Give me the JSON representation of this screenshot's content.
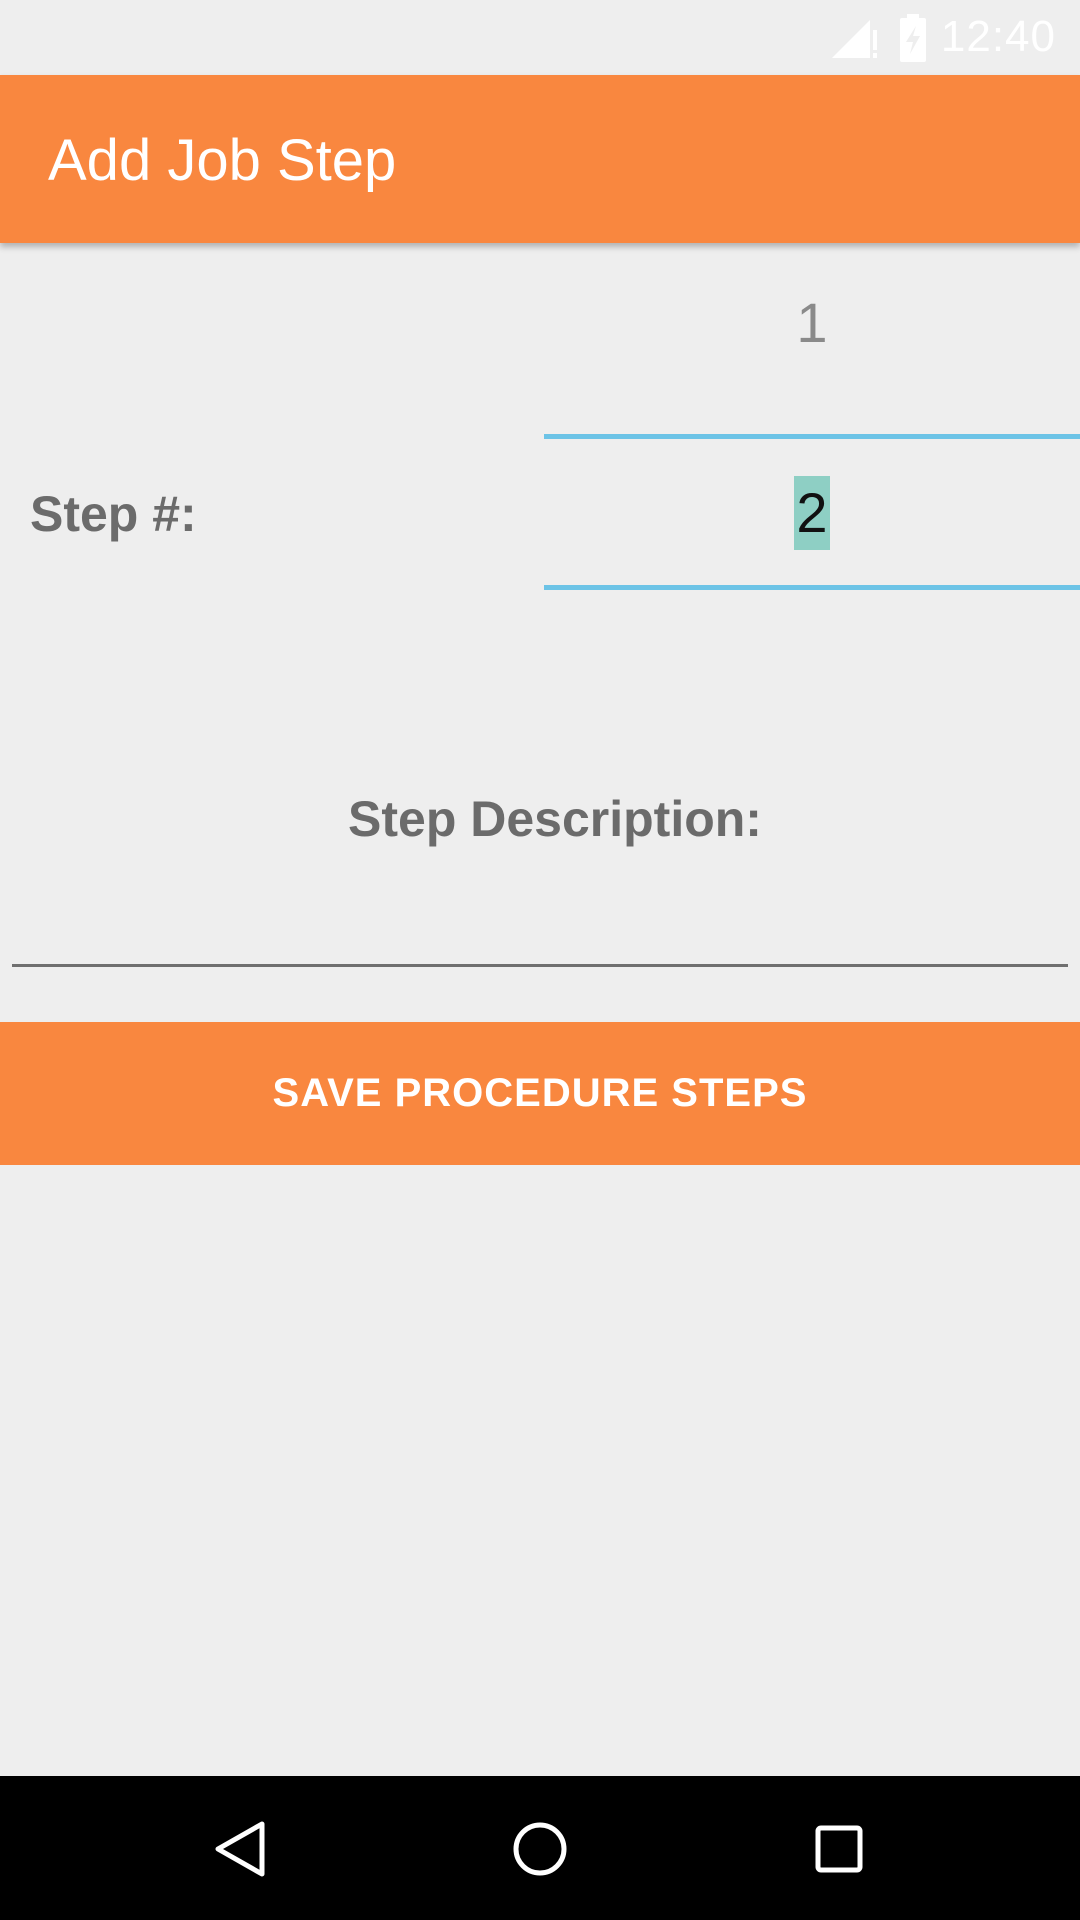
{
  "status_bar": {
    "time": "12:40",
    "icons": [
      "signal-no-data-icon",
      "battery-charging-icon"
    ]
  },
  "app_bar": {
    "title": "Add Job Step",
    "color": "#f9873f"
  },
  "form": {
    "previous_step_value": "1",
    "step_label": "Step #:",
    "step_value": "2",
    "description_label": "Step Description:",
    "description_value": ""
  },
  "save_button": {
    "label": "SAVE PROCEDURE STEPS"
  },
  "nav_bar": {
    "icons": [
      "back-icon",
      "home-icon",
      "recents-icon"
    ]
  },
  "colors": {
    "accent": "#f9873f",
    "picker_divider": "#6cc3e6",
    "selection": "#8ecfc4",
    "label": "#6b6b6b"
  }
}
